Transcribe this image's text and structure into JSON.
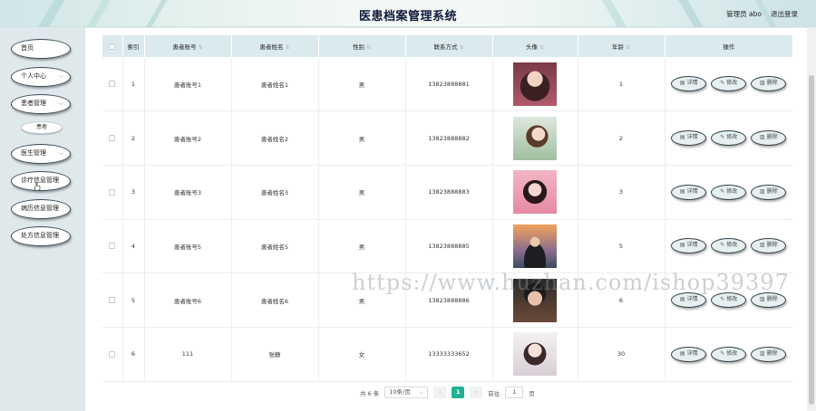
{
  "header": {
    "title": "医患档案管理系统",
    "user_label": "管理员 abo",
    "logout_label": "退出登录"
  },
  "sidebar": {
    "items": [
      {
        "label": "首页",
        "has_chevron": false
      },
      {
        "label": "个人中心",
        "has_chevron": true
      },
      {
        "label": "患者管理",
        "has_chevron": true
      },
      {
        "label": "医生管理",
        "has_chevron": true
      },
      {
        "label": "诊疗信息管理",
        "has_chevron": false
      },
      {
        "label": "病历信息管理",
        "has_chevron": false
      },
      {
        "label": "处方信息管理",
        "has_chevron": false
      }
    ],
    "sub_item": "患者"
  },
  "table": {
    "columns": [
      "索引",
      "患者账号",
      "患者姓名",
      "性别",
      "联系方式",
      "头像",
      "年龄",
      "操作"
    ],
    "rows": [
      {
        "index": "1",
        "account": "患者账号1",
        "name": "患者姓名1",
        "gender": "男",
        "phone": "13823888881",
        "age": "1"
      },
      {
        "index": "2",
        "account": "患者账号2",
        "name": "患者姓名2",
        "gender": "男",
        "phone": "13823888882",
        "age": "2"
      },
      {
        "index": "3",
        "account": "患者账号3",
        "name": "患者姓名3",
        "gender": "男",
        "phone": "13823888883",
        "age": "3"
      },
      {
        "index": "4",
        "account": "患者账号5",
        "name": "患者姓名5",
        "gender": "男",
        "phone": "13823888885",
        "age": "5"
      },
      {
        "index": "5",
        "account": "患者账号6",
        "name": "患者姓名6",
        "gender": "男",
        "phone": "13823888886",
        "age": "6"
      },
      {
        "index": "6",
        "account": "111",
        "name": "张静",
        "gender": "女",
        "phone": "13333333652",
        "age": "30"
      }
    ],
    "actions": {
      "detail": "详情",
      "edit": "修改",
      "delete": "删除"
    }
  },
  "pagination": {
    "total": "共 6 条",
    "page_size": "10条/页",
    "current_page": "1",
    "goto_label": "前往",
    "goto_value": "1",
    "page_suffix": "页"
  },
  "watermark": "https://www.huzhan.com/ishop39397"
}
